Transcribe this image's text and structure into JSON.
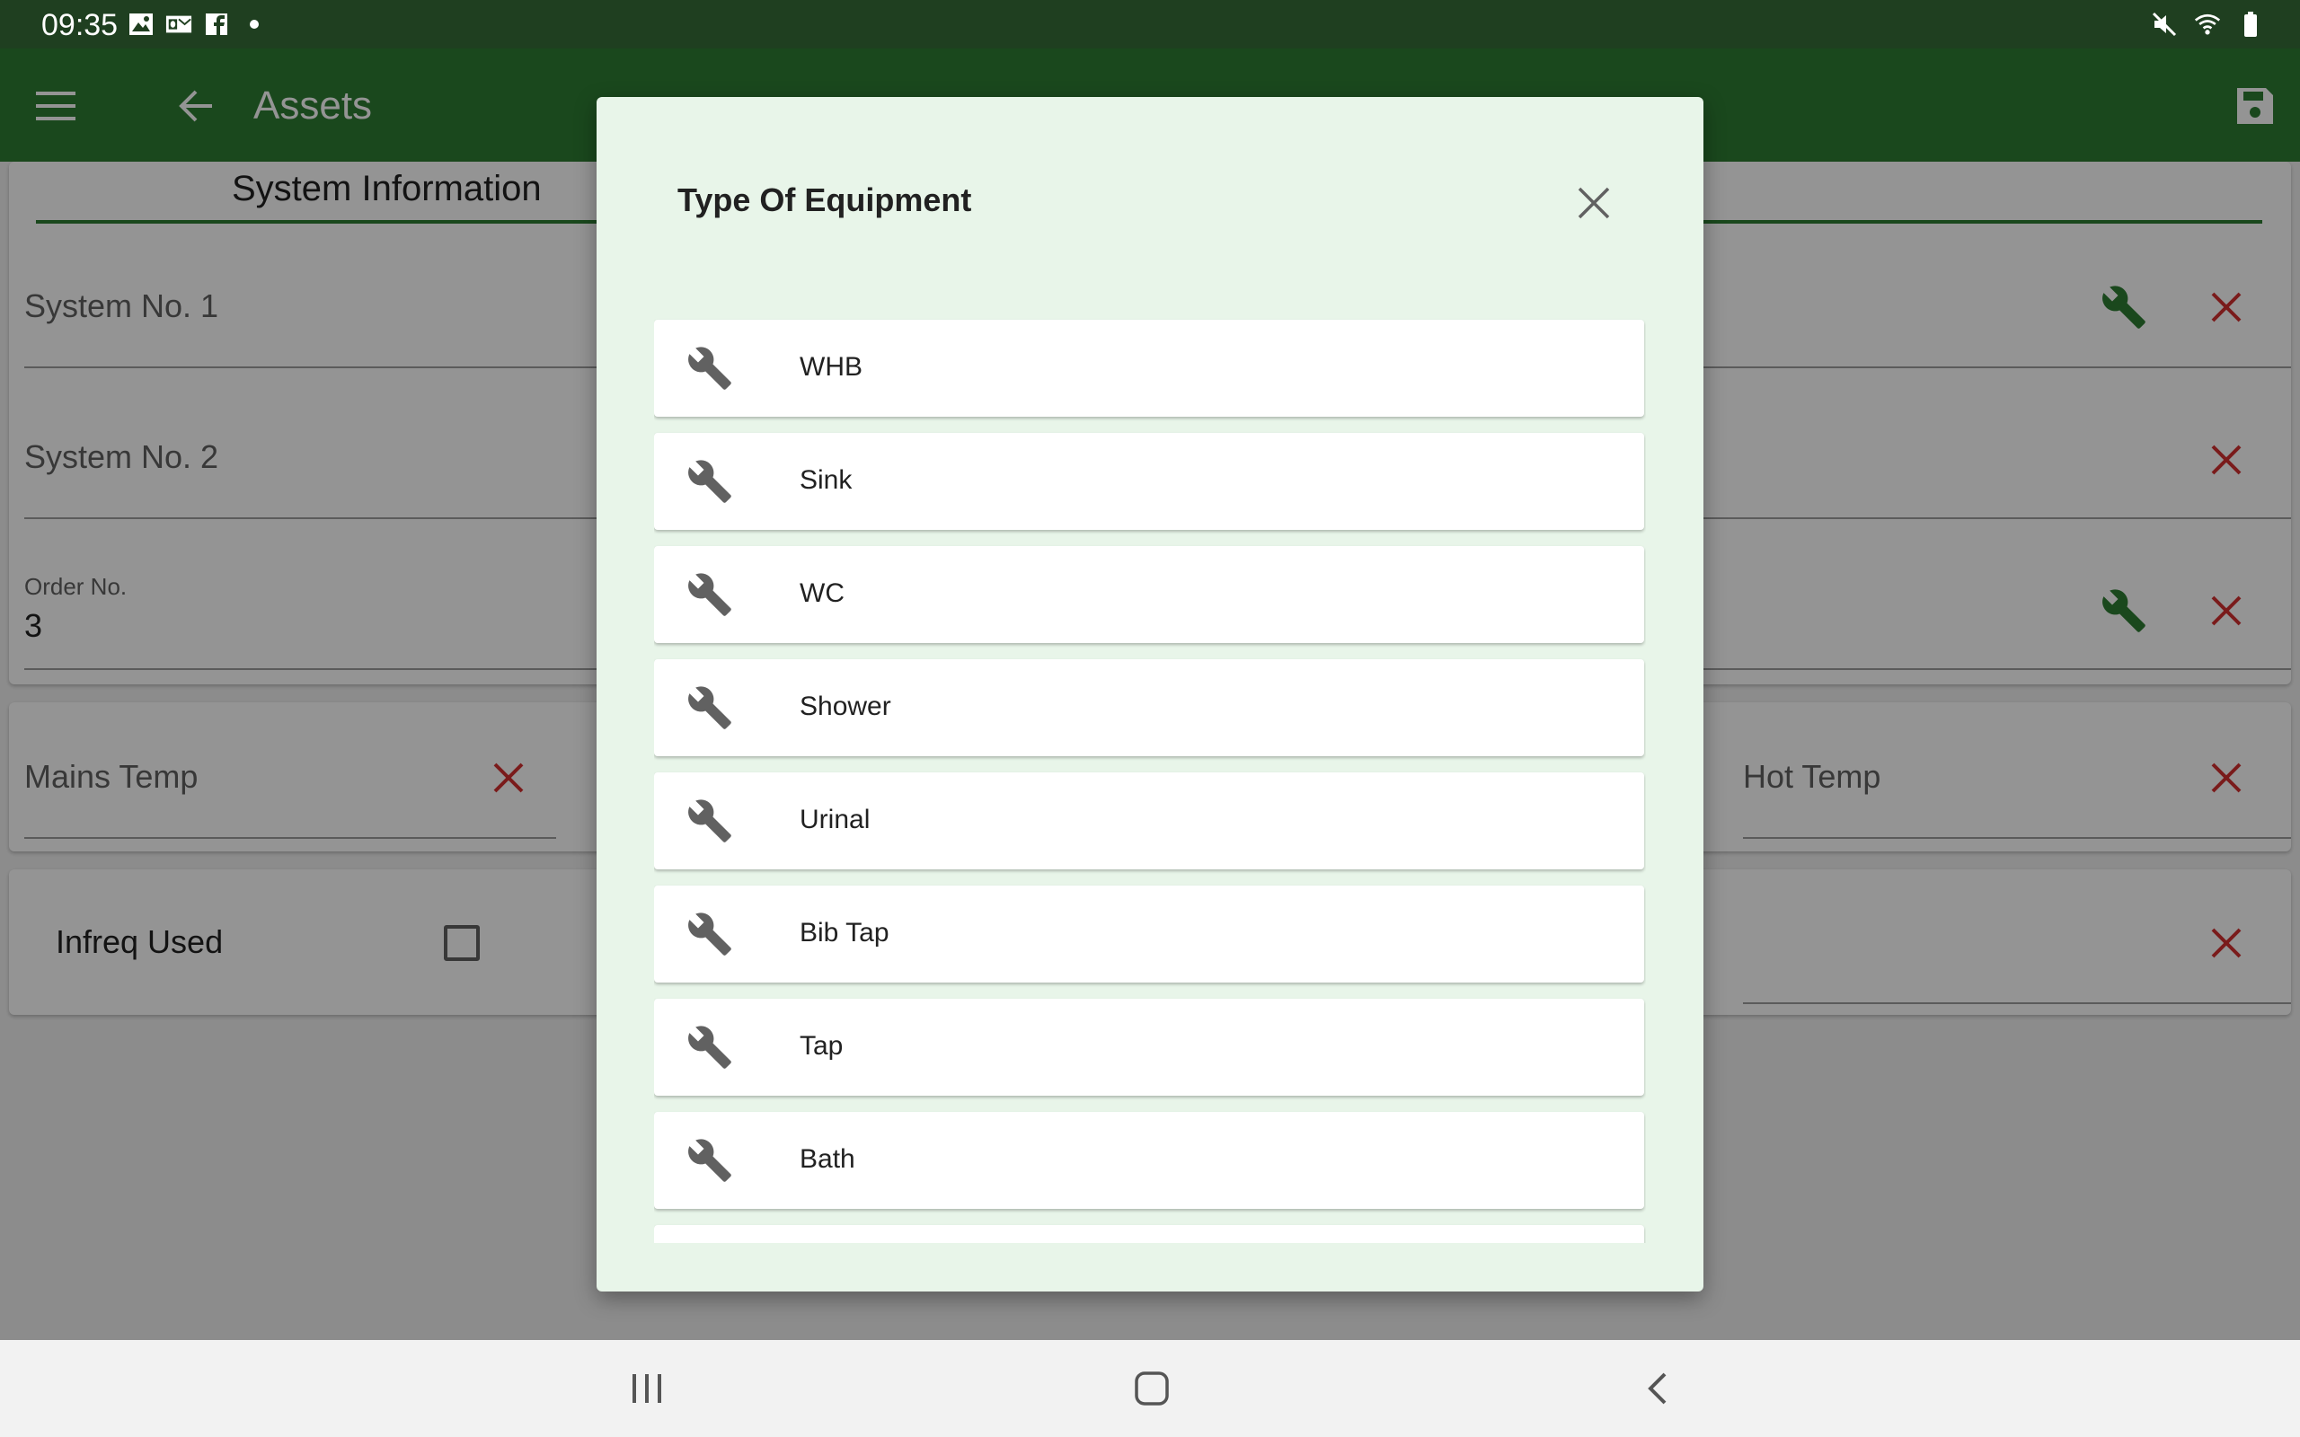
{
  "status_bar": {
    "time": "09:35",
    "left_icons": [
      "image-icon",
      "outlook-icon",
      "facebook-icon",
      "dot-icon"
    ],
    "right_icons": [
      "mute-icon",
      "wifi-icon",
      "battery-icon"
    ]
  },
  "app_bar": {
    "title": "Assets",
    "menu_icon": "menu-icon",
    "back_icon": "arrow-back-icon",
    "save_icon": "save-icon",
    "color": "#2e7d32"
  },
  "form": {
    "tab_label": "System Information",
    "fields": {
      "system_no_1": {
        "label": "System No. 1"
      },
      "system_no_2": {
        "label": "System No. 2"
      },
      "order_no": {
        "label": "Order No.",
        "value": "3"
      },
      "mains_temp": {
        "label": "Mains Temp"
      },
      "hot_temp": {
        "label": "Hot Temp"
      },
      "infreq_used": {
        "label": "Infreq Used",
        "checked": false
      }
    },
    "colors": {
      "wrench": "#2e7d32",
      "clear": "#d32f2f"
    }
  },
  "dialog": {
    "title": "Type Of Equipment",
    "close_icon": "close-icon",
    "options": [
      {
        "label": "WHB",
        "icon": "wrench-icon"
      },
      {
        "label": "Sink",
        "icon": "wrench-icon"
      },
      {
        "label": "WC",
        "icon": "wrench-icon"
      },
      {
        "label": "Shower",
        "icon": "wrench-icon"
      },
      {
        "label": "Urinal",
        "icon": "wrench-icon"
      },
      {
        "label": "Bib Tap",
        "icon": "wrench-icon"
      },
      {
        "label": "Tap",
        "icon": "wrench-icon"
      },
      {
        "label": "Bath",
        "icon": "wrench-icon"
      },
      {
        "label": "",
        "icon": "wrench-icon"
      }
    ]
  },
  "nav_bar": {
    "buttons": [
      "recent-apps-icon",
      "home-icon",
      "back-icon"
    ]
  }
}
